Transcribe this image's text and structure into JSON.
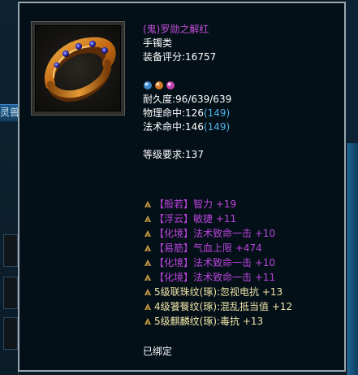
{
  "background": {
    "partial_tab_text": "灵兽"
  },
  "item": {
    "name": "(鬼)罗勋之解红",
    "type": "手镯类",
    "score_label": "装备评分:",
    "score": "16757",
    "durability_label": "耐久度:",
    "durability": "96/639/639",
    "physical_hit_label": "物理命中:",
    "physical_hit": "126",
    "physical_hit_bonus": "(149)",
    "magic_hit_label": "法术命中:",
    "magic_hit": "146",
    "magic_hit_bonus": "(149)",
    "level_req_label": "等级要求:",
    "level_req": "137",
    "gem_icons": [
      "gem-icon-blue",
      "gem-icon-orange",
      "gem-icon-pink"
    ]
  },
  "stats": [
    {
      "text": "【般若】智力 +19",
      "color": "purple"
    },
    {
      "text": "【浮云】敏捷 +11",
      "color": "purple"
    },
    {
      "text": "【化境】法术致命一击 +10",
      "color": "purple"
    },
    {
      "text": "【易筋】气血上限 +474",
      "color": "purple"
    },
    {
      "text": "【化境】法术致命一击 +10",
      "color": "purple"
    },
    {
      "text": "【化境】法术致命一击 +11",
      "color": "purple"
    },
    {
      "text": "5级联珠纹(琢):忽视电抗 +13",
      "color": "yellow"
    },
    {
      "text": "4级饕餮纹(琢):混乱抵当值 +12",
      "color": "yellow"
    },
    {
      "text": "5级麒麟纹(琢):毒抗 +13",
      "color": "yellow"
    }
  ],
  "bound_text": "已绑定",
  "colors": {
    "name": "#c14ed9",
    "bonus_blue": "#4fb4e8",
    "enchant_purple": "#bb44dd",
    "rune_yellow": "#f0e6a8",
    "tooltip_bg": "#041018",
    "tooltip_border": "#98a6ad"
  }
}
